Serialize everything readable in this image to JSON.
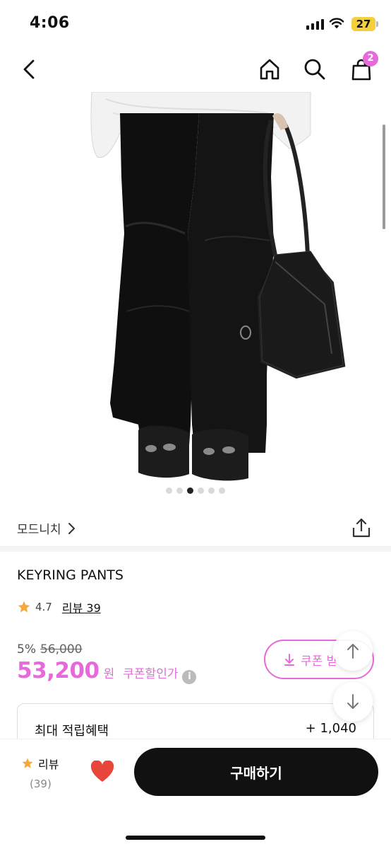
{
  "status_bar": {
    "time": "4:06",
    "battery": "27",
    "battery_color": "#f4d03f"
  },
  "nav": {
    "back_icon": "chevron-left-icon",
    "home_icon": "home-icon",
    "search_icon": "search-icon",
    "cart_icon": "shopping-bag-icon",
    "cart_badge": "2",
    "badge_color": "#e66ad9"
  },
  "gallery": {
    "dots_total": 6,
    "active_index": 2
  },
  "brand": {
    "name": "모드니치",
    "chevron": "›",
    "share_icon": "share-icon"
  },
  "product": {
    "name": "KEYRING PANTS",
    "rating": "4.7",
    "reviews_label": "리뷰 39"
  },
  "price": {
    "discount": "5%",
    "original": "56,000",
    "amount": "53,200",
    "currency": "원",
    "coupon_label": "쿠폰할인가",
    "info_icon": "i",
    "accent_color": "#e66ad9"
  },
  "coupon_button": {
    "label": "쿠폰 받",
    "icon": "download-arrow-icon"
  },
  "benefit": {
    "label": "최대 적립혜택",
    "value": "+ 1,040"
  },
  "bottom_bar": {
    "review_label": "리뷰",
    "review_count": "(39)",
    "heart_color": "#e8463a",
    "buy_label": "구매하기"
  }
}
